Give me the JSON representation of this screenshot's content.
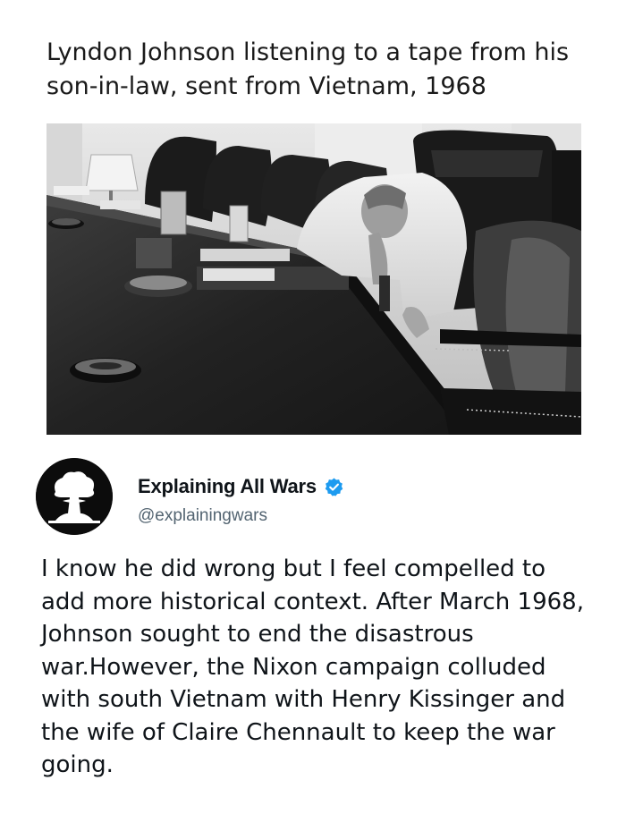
{
  "caption": "Lyndon Johnson listening to a tape from his son-in-law, sent from Vietnam, 1968",
  "tweet": {
    "display_name": "Explaining All Wars",
    "handle": "@explainingwars",
    "verified": true,
    "avatar_icon": "mushroom-cloud-icon",
    "text": "I know he did wrong but I feel compelled to add more historical context. After March 1968, Johnson sought to end the disastrous war.However, the Nixon campaign colluded with south Vietnam with Henry Kissinger and the wife of Claire Chennault to keep the war going."
  },
  "colors": {
    "verified_badge": "#1d9bf0",
    "handle": "#536471",
    "text": "#0f1419"
  }
}
